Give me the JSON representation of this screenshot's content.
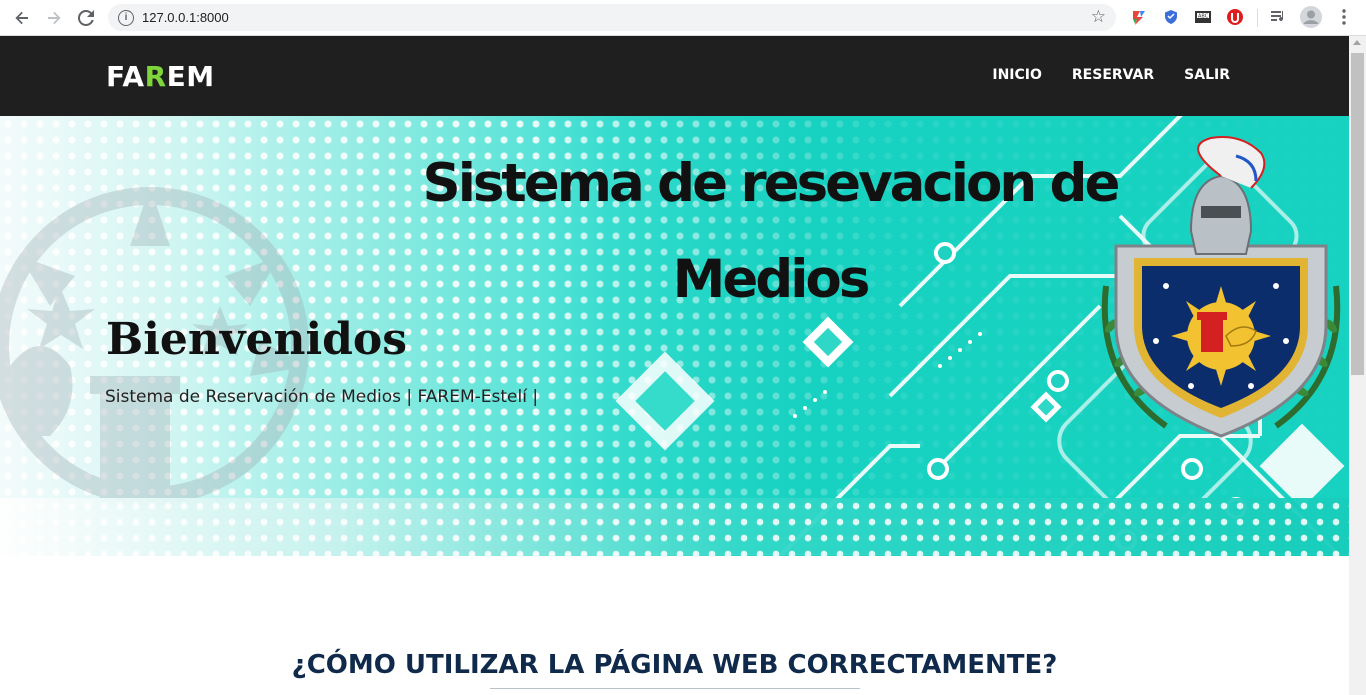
{
  "browser": {
    "url": "127.0.0.1:8000"
  },
  "site": {
    "logo_parts": [
      "FA",
      "R",
      "EM"
    ],
    "nav": {
      "inicio": "INICIO",
      "reservar": "RESERVAR",
      "salir": "SALIR"
    }
  },
  "hero": {
    "title_line1": "Sistema de resevacion de",
    "title_line2": "Medios",
    "welcome": "Bienvenidos",
    "subtitle": "Sistema de Reservación de Medios | FAREM-Estelí |"
  },
  "section": {
    "title": "¿CÓMO UTILIZAR LA PÁGINA WEB CORRECTAMENTE?"
  },
  "colors": {
    "header_bg": "#1f1f1f",
    "logo_accent": "#7fd63a",
    "hero_teal": "#18d2c1",
    "section_title": "#102a4c"
  },
  "icons": [
    "back-arrow-icon",
    "forward-arrow-icon",
    "reload-icon",
    "info-icon",
    "bookmark-star-icon",
    "extension-icons",
    "media-icon",
    "profile-avatar-icon",
    "menu-dots-icon"
  ]
}
